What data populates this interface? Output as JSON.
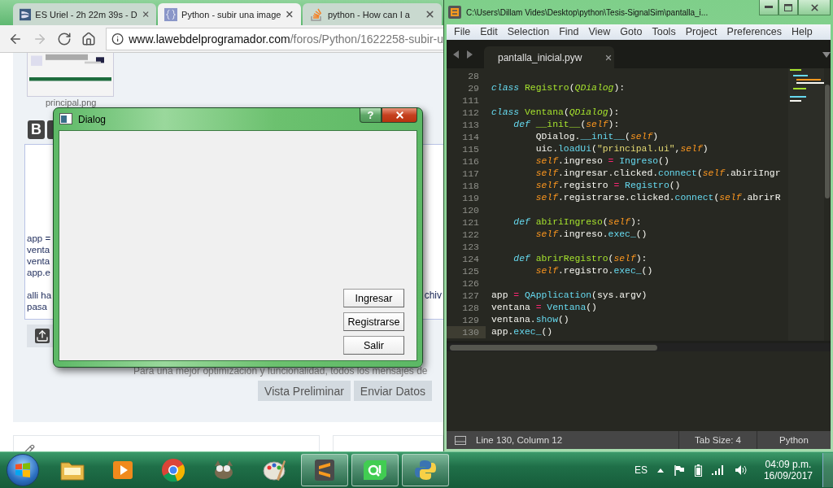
{
  "browser": {
    "tabs": [
      {
        "title": "ES Uriel - 2h 22m 39s - D",
        "selected": false
      },
      {
        "title": "Python - subir una image",
        "selected": true
      },
      {
        "title": "python - How can I a",
        "selected": false
      }
    ],
    "url": {
      "host": "www.lawebdelprogramador.com",
      "path": "/foros/Python/1622258-subir-u"
    },
    "page": {
      "attachment_name": "principal.png",
      "bold_button": "B",
      "paragraphs": [
        [
          "app =",
          "venta",
          "venta",
          "app.e"
        ],
        [
          "alli ha",
          "pasa"
        ]
      ],
      "cut_fragment": "chiv",
      "notice": "Para una mejor optimización y funcionalidad, todos los mensajes de",
      "buttons": [
        "Vista Preliminar",
        "Enviar Datos"
      ]
    }
  },
  "dialog": {
    "title": "Dialog",
    "help": "?",
    "buttons": [
      "Ingresar",
      "Registrarse",
      "Salir"
    ]
  },
  "editor": {
    "title": "C:\\Users\\Dillam Vides\\Desktop\\python\\Tesis-SignalSim\\pantalla_i...",
    "menu": [
      "File",
      "Edit",
      "Selection",
      "Find",
      "View",
      "Goto",
      "Tools",
      "Project",
      "Preferences",
      "Help"
    ],
    "tab": "pantalla_inicial.pyw",
    "lines": [
      {
        "number": "28",
        "current": false
      },
      {
        "number": "29",
        "current": false,
        "tokens": [
          {
            "text": "class ",
            "kind": "keyword"
          },
          {
            "text": "Registro",
            "kind": "name"
          },
          {
            "text": "(",
            "kind": "plain"
          },
          {
            "text": "QDialog",
            "kind": "base"
          },
          {
            "text": "):",
            "kind": "plain"
          }
        ]
      },
      {
        "number": "111",
        "current": false
      },
      {
        "number": "112",
        "current": false,
        "tokens": [
          {
            "text": "class ",
            "kind": "keyword"
          },
          {
            "text": "Ventana",
            "kind": "name"
          },
          {
            "text": "(",
            "kind": "plain"
          },
          {
            "text": "QDialog",
            "kind": "base"
          },
          {
            "text": "):",
            "kind": "plain"
          }
        ]
      },
      {
        "number": "113",
        "current": false,
        "tokens": [
          {
            "text": "    def ",
            "kind": "keyword"
          },
          {
            "text": "__init__",
            "kind": "name"
          },
          {
            "text": "(",
            "kind": "plain"
          },
          {
            "text": "self",
            "kind": "self"
          },
          {
            "text": "):",
            "kind": "plain"
          }
        ]
      },
      {
        "number": "114",
        "current": false,
        "tokens": [
          {
            "text": "        QDialog.",
            "kind": "plain"
          },
          {
            "text": "__init__",
            "kind": "call"
          },
          {
            "text": "(",
            "kind": "plain"
          },
          {
            "text": "self",
            "kind": "self"
          },
          {
            "text": ")",
            "kind": "plain"
          }
        ]
      },
      {
        "number": "115",
        "current": false,
        "tokens": [
          {
            "text": "        uic.",
            "kind": "plain"
          },
          {
            "text": "loadUi",
            "kind": "call"
          },
          {
            "text": "(",
            "kind": "plain"
          },
          {
            "text": "\"principal.ui\"",
            "kind": "string"
          },
          {
            "text": ",",
            "kind": "plain"
          },
          {
            "text": "self",
            "kind": "self"
          },
          {
            "text": ")",
            "kind": "plain"
          }
        ]
      },
      {
        "number": "116",
        "current": false,
        "tokens": [
          {
            "text": "        self",
            "kind": "self"
          },
          {
            "text": ".ingreso ",
            "kind": "plain"
          },
          {
            "text": "=",
            "kind": "op"
          },
          {
            "text": " Ingreso",
            "kind": "call"
          },
          {
            "text": "()",
            "kind": "plain"
          }
        ]
      },
      {
        "number": "117",
        "current": false,
        "tokens": [
          {
            "text": "        self",
            "kind": "self"
          },
          {
            "text": ".ingresar.clicked.",
            "kind": "plain"
          },
          {
            "text": "connect",
            "kind": "call"
          },
          {
            "text": "(",
            "kind": "plain"
          },
          {
            "text": "self",
            "kind": "self"
          },
          {
            "text": ".abiriIngr",
            "kind": "plain"
          }
        ]
      },
      {
        "number": "118",
        "current": false,
        "tokens": [
          {
            "text": "        self",
            "kind": "self"
          },
          {
            "text": ".registro ",
            "kind": "plain"
          },
          {
            "text": "=",
            "kind": "op"
          },
          {
            "text": " Registro",
            "kind": "call"
          },
          {
            "text": "()",
            "kind": "plain"
          }
        ]
      },
      {
        "number": "119",
        "current": false,
        "tokens": [
          {
            "text": "        self",
            "kind": "self"
          },
          {
            "text": ".registrarse.clicked.",
            "kind": "plain"
          },
          {
            "text": "connect",
            "kind": "call"
          },
          {
            "text": "(",
            "kind": "plain"
          },
          {
            "text": "self",
            "kind": "self"
          },
          {
            "text": ".abrirR",
            "kind": "plain"
          }
        ]
      },
      {
        "number": "120",
        "current": false
      },
      {
        "number": "121",
        "current": false,
        "tokens": [
          {
            "text": "    def ",
            "kind": "keyword"
          },
          {
            "text": "abiriIngreso",
            "kind": "name"
          },
          {
            "text": "(",
            "kind": "plain"
          },
          {
            "text": "self",
            "kind": "self"
          },
          {
            "text": "):",
            "kind": "plain"
          }
        ]
      },
      {
        "number": "122",
        "current": false,
        "tokens": [
          {
            "text": "        self",
            "kind": "self"
          },
          {
            "text": ".ingreso.",
            "kind": "plain"
          },
          {
            "text": "exec_",
            "kind": "call"
          },
          {
            "text": "()",
            "kind": "plain"
          }
        ]
      },
      {
        "number": "123",
        "current": false
      },
      {
        "number": "124",
        "current": false,
        "tokens": [
          {
            "text": "    def ",
            "kind": "keyword"
          },
          {
            "text": "abrirRegistro",
            "kind": "name"
          },
          {
            "text": "(",
            "kind": "plain"
          },
          {
            "text": "self",
            "kind": "self"
          },
          {
            "text": "):",
            "kind": "plain"
          }
        ]
      },
      {
        "number": "125",
        "current": false,
        "tokens": [
          {
            "text": "        self",
            "kind": "self"
          },
          {
            "text": ".registro.",
            "kind": "plain"
          },
          {
            "text": "exec_",
            "kind": "call"
          },
          {
            "text": "()",
            "kind": "plain"
          }
        ]
      },
      {
        "number": "126",
        "current": false
      },
      {
        "number": "127",
        "current": false,
        "tokens": [
          {
            "text": "app ",
            "kind": "plain"
          },
          {
            "text": "=",
            "kind": "op"
          },
          {
            "text": " QApplication",
            "kind": "call"
          },
          {
            "text": "(sys.argv)",
            "kind": "plain"
          }
        ]
      },
      {
        "number": "128",
        "current": false,
        "tokens": [
          {
            "text": "ventana ",
            "kind": "plain"
          },
          {
            "text": "=",
            "kind": "op"
          },
          {
            "text": " Ventana",
            "kind": "call"
          },
          {
            "text": "()",
            "kind": "plain"
          }
        ]
      },
      {
        "number": "129",
        "current": false,
        "tokens": [
          {
            "text": "ventana.",
            "kind": "plain"
          },
          {
            "text": "show",
            "kind": "call"
          },
          {
            "text": "()",
            "kind": "plain"
          }
        ]
      },
      {
        "number": "130",
        "current": true,
        "tokens": [
          {
            "text": "app.",
            "kind": "plain"
          },
          {
            "text": "exec_",
            "kind": "call"
          },
          {
            "text": "()",
            "kind": "plain"
          }
        ]
      }
    ],
    "status": {
      "position": "Line 130, Column 12",
      "tab_size": "Tab Size: 4",
      "syntax": "Python"
    }
  },
  "taskbar": {
    "items": [
      {
        "open": false
      },
      {
        "open": false
      },
      {
        "open": false
      },
      {
        "open": false
      },
      {
        "open": false
      },
      {
        "open": true
      },
      {
        "open": true
      },
      {
        "open": true
      }
    ],
    "tray": {
      "language": "ES",
      "time": "04:09 p.m.",
      "date": "16/09/2017"
    }
  }
}
